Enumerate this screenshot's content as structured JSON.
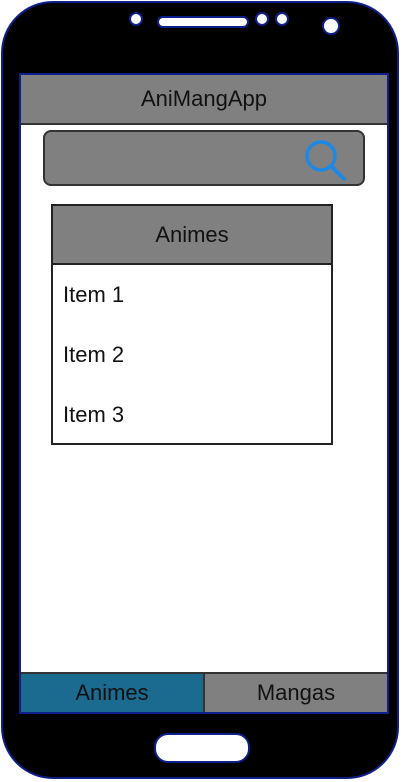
{
  "app": {
    "title": "AniMangApp"
  },
  "search": {
    "icon": "search-icon",
    "value": ""
  },
  "list": {
    "header": "Animes",
    "items": [
      {
        "label": "Item 1"
      },
      {
        "label": "Item 2"
      },
      {
        "label": "Item 3"
      }
    ]
  },
  "tabs": [
    {
      "label": "Animes",
      "active": true
    },
    {
      "label": "Mangas",
      "active": false
    }
  ],
  "colors": {
    "frame": "#000000",
    "frame_border": "#0d1f8a",
    "bar_gray": "#808080",
    "active_tab": "#1a6b8f",
    "search_icon": "#1e88e5"
  }
}
